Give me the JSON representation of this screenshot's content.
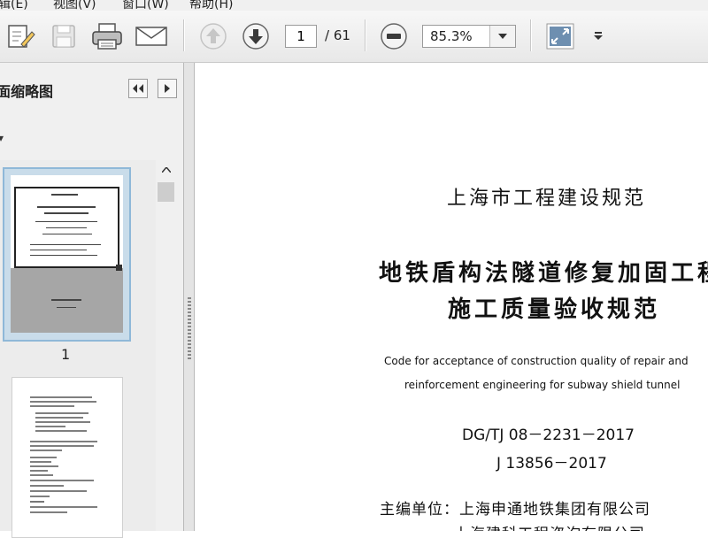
{
  "menu": {
    "items": [
      "辑(E)",
      "视图(V)",
      "窗口(W)",
      "帮助(H)"
    ]
  },
  "toolbar": {
    "icons": [
      "edit-icon",
      "save-icon",
      "print-icon",
      "email-icon",
      "previous-page-icon",
      "next-page-icon",
      "zoom-out-icon",
      "fit-page-icon",
      "toolbar-more-icon"
    ],
    "current_page": "1",
    "page_total": "/ 61",
    "zoom": "85.3%"
  },
  "sidebar": {
    "title": "面缩略图",
    "options_arrow": "▾",
    "thumbnails": [
      {
        "label": "1",
        "selected": true
      },
      {
        "label": "",
        "selected": false
      }
    ]
  },
  "document": {
    "series": "上海市工程建设规范",
    "title_line1": "地铁盾构法隧道修复加固工程",
    "title_line2": "施工质量验收规范",
    "english_line1": "Code for acceptance of construction quality of repair and",
    "english_line2": "reinforcement engineering for subway shield tunnel",
    "code1": "DG/TJ 08－2231－2017",
    "code2": "J 13856－2017",
    "editor1": "主编单位：上海申通地铁集团有限公司",
    "editor2": "上海建科工程咨询有限公司"
  },
  "colors": {
    "toolbar_bg": "#ececec",
    "selection_border": "#8fb8d8",
    "thumb_gray": "#a6a6a6"
  }
}
